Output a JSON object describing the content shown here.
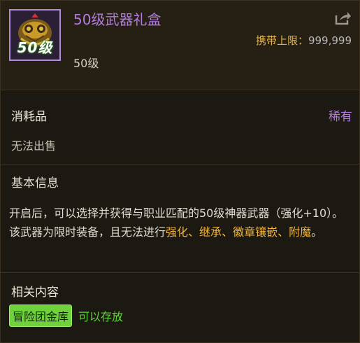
{
  "item": {
    "name": "50级武器礼盒",
    "icon_level": "50级",
    "level_text": "50级",
    "carry_limit_label": "携带上限：",
    "carry_limit_value": "999,999",
    "share_icon": "share-arrow-icon",
    "category": "消耗品",
    "rarity": "稀有",
    "sell_status": "无法出售"
  },
  "basic_info": {
    "title": "基本信息",
    "desc_part1": "开启后，可以选择并获得与职业匹配的50级神器武器（强化+10）。该武器为限时装备，且无法进行",
    "hl1": "强化",
    "sep1": "、",
    "hl2": "继承",
    "sep2": "、",
    "hl3": "徽章镶嵌",
    "sep3": "、",
    "hl4": "附魔",
    "end": "。"
  },
  "related": {
    "title": "相关内容",
    "badge": "冒险团金库",
    "status": "可以存放"
  },
  "colors": {
    "name_purple": "#b27be0",
    "highlight_orange": "#f0b43c",
    "gold_label": "#e0b450",
    "green": "#63d63a"
  }
}
